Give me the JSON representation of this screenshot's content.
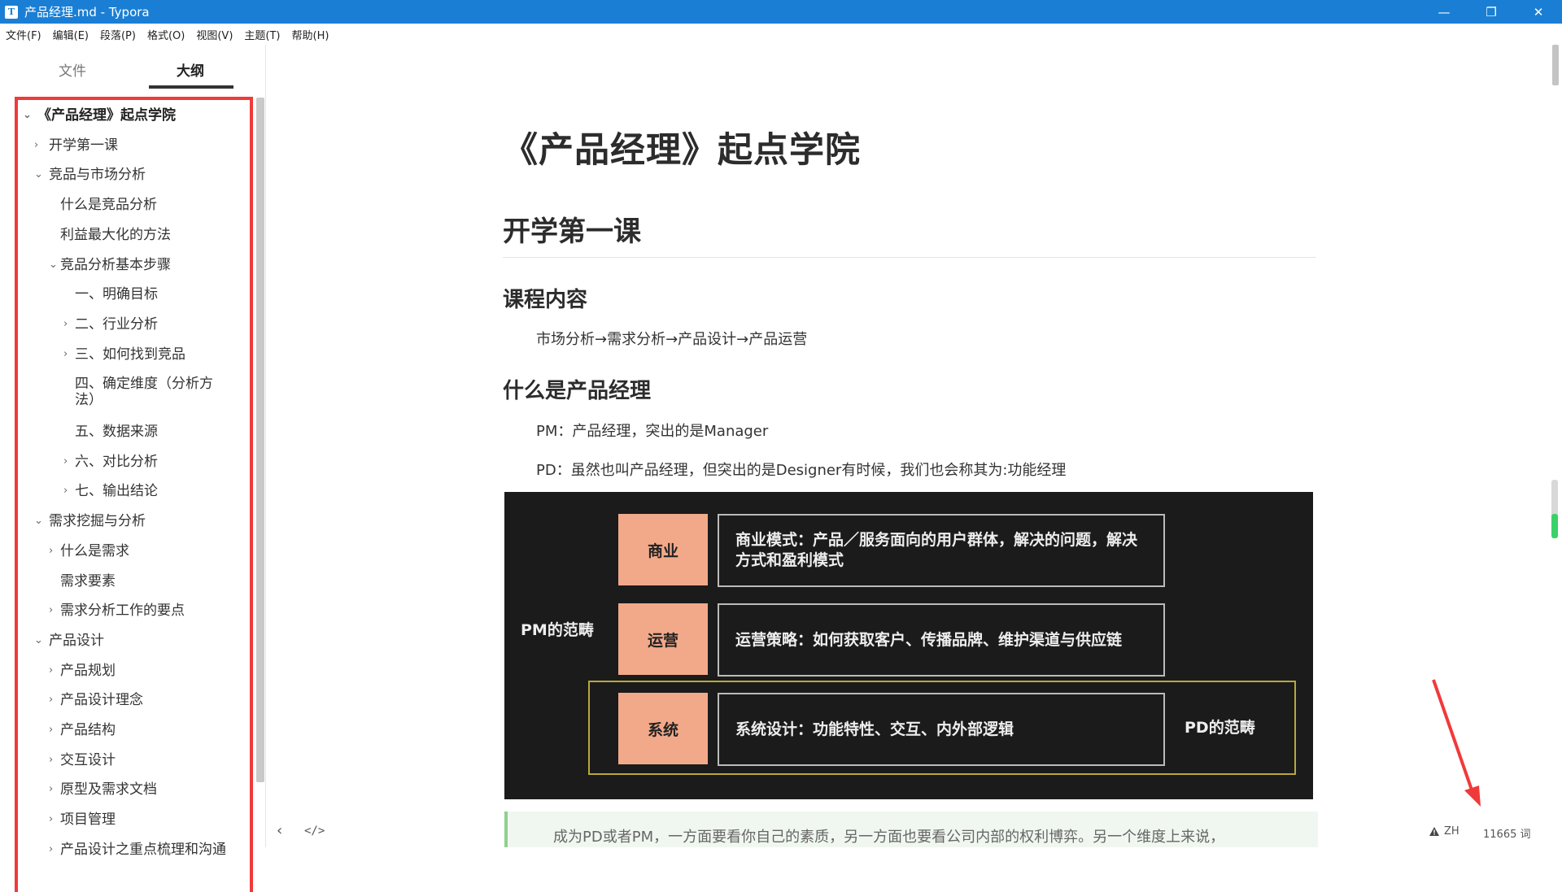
{
  "window": {
    "title": "产品经理.md - Typora",
    "app_icon": "T",
    "minimize": "—",
    "restore": "❐",
    "close": "✕"
  },
  "menu": [
    "文件(F)",
    "编辑(E)",
    "段落(P)",
    "格式(O)",
    "视图(V)",
    "主题(T)",
    "帮助(H)"
  ],
  "sidebar": {
    "tabs": {
      "files": "文件",
      "outline": "大纲"
    },
    "active_tab": "outline",
    "outline": [
      {
        "label": "《产品经理》起点学院",
        "level": 0,
        "chevron": "⌄"
      },
      {
        "label": "开学第一课",
        "level": 1,
        "chevron": "›"
      },
      {
        "label": "竞品与市场分析",
        "level": 1,
        "chevron": "⌄"
      },
      {
        "label": "什么是竞品分析",
        "level": 2,
        "chevron": ""
      },
      {
        "label": "利益最大化的方法",
        "level": 2,
        "chevron": ""
      },
      {
        "label": "竞品分析基本步骤",
        "level": 2,
        "chevron": "⌄"
      },
      {
        "label": "一、明确目标",
        "level": 3,
        "chevron": ""
      },
      {
        "label": "二、行业分析",
        "level": 3,
        "chevron": "›"
      },
      {
        "label": "三、如何找到竞品",
        "level": 3,
        "chevron": "›"
      },
      {
        "label": "四、确定维度（分析方",
        "label2": "法）",
        "level": 3,
        "chevron": ""
      },
      {
        "label": "五、数据来源",
        "level": 3,
        "chevron": ""
      },
      {
        "label": "六、对比分析",
        "level": 3,
        "chevron": "›"
      },
      {
        "label": "七、输出结论",
        "level": 3,
        "chevron": "›"
      },
      {
        "label": "需求挖掘与分析",
        "level": 1,
        "chevron": "⌄"
      },
      {
        "label": "什么是需求",
        "level": 2,
        "chevron": "›"
      },
      {
        "label": "需求要素",
        "level": 2,
        "chevron": ""
      },
      {
        "label": "需求分析工作的要点",
        "level": 2,
        "chevron": "›"
      },
      {
        "label": "产品设计",
        "level": 1,
        "chevron": "⌄"
      },
      {
        "label": "产品规划",
        "level": 2,
        "chevron": "›"
      },
      {
        "label": "产品设计理念",
        "level": 2,
        "chevron": "›"
      },
      {
        "label": "产品结构",
        "level": 2,
        "chevron": "›"
      },
      {
        "label": "交互设计",
        "level": 2,
        "chevron": "›"
      },
      {
        "label": "原型及需求文档",
        "level": 2,
        "chevron": "›"
      },
      {
        "label": "项目管理",
        "level": 2,
        "chevron": "›"
      },
      {
        "label": "产品设计之重点梳理和沟通",
        "level": 2,
        "chevron": "›"
      }
    ],
    "bottom_left": "‹",
    "bottom_code": "</>"
  },
  "document": {
    "h1": "《产品经理》起点学院",
    "h2": "开学第一课",
    "h3_course": "课程内容",
    "course_text": "市场分析→需求分析→产品设计→产品运营",
    "h3_pm": "什么是产品经理",
    "pm_text": "PM：产品经理，突出的是Manager",
    "pd_text": "PD：虽然也叫产品经理，但突出的是Designer有时候，我们也会称其为:功能经理",
    "slide": {
      "pm_scope": "PM的范畴",
      "pd_scope": "PD的范畴",
      "rows": [
        {
          "tag": "商业",
          "desc": "商业模式：产品／服务面向的用户群体，解决的问题，解决方式和盈利模式"
        },
        {
          "tag": "运营",
          "desc": "运营策略：如何获取客户、传播品牌、维护渠道与供应链"
        },
        {
          "tag": "系统",
          "desc": "系统设计：功能特性、交互、内外部逻辑"
        }
      ]
    },
    "quote": "成为PD或者PM，一方面要看你自己的素质，另一方面也要看公司内部的权利博弈。另一个维度上来说，"
  },
  "status": {
    "warning_icon": "warning-icon",
    "lang": "ZH",
    "word_count": "11665 词"
  },
  "colors": {
    "titlebar": "#1a7fd4",
    "highlight_border": "#f03a3a",
    "slide_tag": "#f2a98a",
    "quote_border": "#8fd08f"
  }
}
